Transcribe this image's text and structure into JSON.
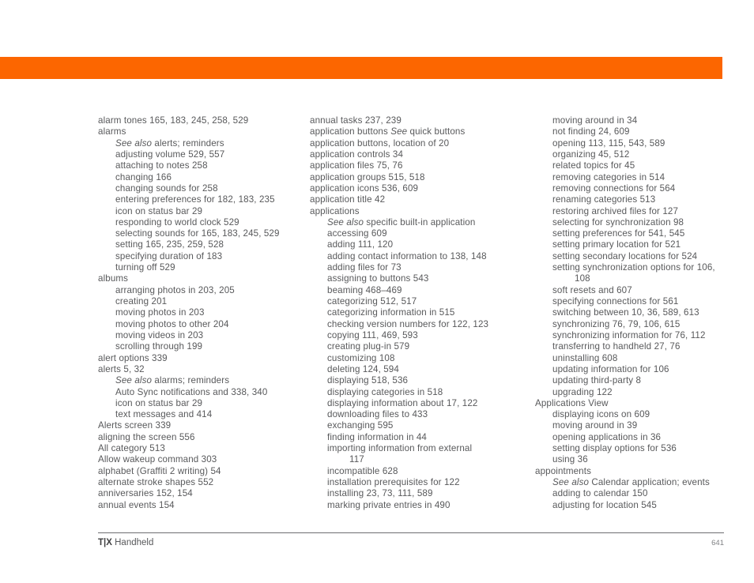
{
  "page": {
    "accent_color": "#fc6600",
    "text_color": "#58595b"
  },
  "footer": {
    "brand": "T|X",
    "product": " Handheld",
    "page_number": "641"
  },
  "columns": [
    {
      "name": "index-column-1",
      "entries": [
        {
          "level": 0,
          "text": "alarm tones 165, 183, 245, 258, 529"
        },
        {
          "level": 0,
          "text": "alarms"
        },
        {
          "level": 1,
          "italic_prefix": "See also",
          "text": " alerts; reminders"
        },
        {
          "level": 1,
          "text": "adjusting volume 529, 557"
        },
        {
          "level": 1,
          "text": "attaching to notes 258"
        },
        {
          "level": 1,
          "text": "changing 166"
        },
        {
          "level": 1,
          "text": "changing sounds for 258"
        },
        {
          "level": 1,
          "text": "entering preferences for 182, 183, 235"
        },
        {
          "level": 1,
          "text": "icon on status bar 29"
        },
        {
          "level": 1,
          "text": "responding to world clock 529"
        },
        {
          "level": 1,
          "text": "selecting sounds for 165, 183, 245, 529"
        },
        {
          "level": 1,
          "text": "setting 165, 235, 259, 528"
        },
        {
          "level": 1,
          "text": "specifying duration of 183"
        },
        {
          "level": 1,
          "text": "turning off 529"
        },
        {
          "level": 0,
          "text": "albums"
        },
        {
          "level": 1,
          "text": "arranging photos in 203, 205"
        },
        {
          "level": 1,
          "text": "creating 201"
        },
        {
          "level": 1,
          "text": "moving photos in 203"
        },
        {
          "level": 1,
          "text": "moving photos to other 204"
        },
        {
          "level": 1,
          "text": "moving videos in 203"
        },
        {
          "level": 1,
          "text": "scrolling through 199"
        },
        {
          "level": 0,
          "text": "alert options 339"
        },
        {
          "level": 0,
          "text": "alerts 5, 32"
        },
        {
          "level": 1,
          "italic_prefix": "See also",
          "text": " alarms; reminders"
        },
        {
          "level": 1,
          "text": "Auto Sync notifications and 338, 340"
        },
        {
          "level": 1,
          "text": "icon on status bar 29"
        },
        {
          "level": 1,
          "text": "text messages and 414"
        },
        {
          "level": 0,
          "text": "Alerts screen 339"
        },
        {
          "level": 0,
          "text": "aligning the screen 556"
        },
        {
          "level": 0,
          "text": "All category 513"
        },
        {
          "level": 0,
          "text": "Allow wakeup command 303"
        },
        {
          "level": 0,
          "text": "alphabet (Graffiti 2 writing) 54"
        },
        {
          "level": 0,
          "text": "alternate stroke shapes 552"
        },
        {
          "level": 0,
          "text": "anniversaries 152, 154"
        },
        {
          "level": 0,
          "text": "annual events 154"
        }
      ]
    },
    {
      "name": "index-column-2",
      "entries": [
        {
          "level": 0,
          "text": "annual tasks 237, 239"
        },
        {
          "level": 0,
          "text": "application buttons ",
          "italic_mid": "See",
          "text_after": " quick buttons"
        },
        {
          "level": 0,
          "text": "application buttons, location of 20"
        },
        {
          "level": 0,
          "text": "application controls 34"
        },
        {
          "level": 0,
          "text": "application files 75, 76"
        },
        {
          "level": 0,
          "text": "application groups 515, 518"
        },
        {
          "level": 0,
          "text": "application icons 536, 609"
        },
        {
          "level": 0,
          "text": "application title 42"
        },
        {
          "level": 0,
          "text": "applications"
        },
        {
          "level": 1,
          "italic_prefix": "See also",
          "text": " specific built-in application"
        },
        {
          "level": 1,
          "text": "accessing 609"
        },
        {
          "level": 1,
          "text": "adding 111, 120"
        },
        {
          "level": 1,
          "text": "adding contact information to 138, 148"
        },
        {
          "level": 1,
          "text": "adding files for 73"
        },
        {
          "level": 1,
          "text": "assigning to buttons 543"
        },
        {
          "level": 1,
          "text": "beaming 468–469"
        },
        {
          "level": 1,
          "text": "categorizing 512, 517"
        },
        {
          "level": 1,
          "text": "categorizing information in 515"
        },
        {
          "level": 1,
          "text": "checking version numbers for 122, 123"
        },
        {
          "level": 1,
          "text": "copying 111, 469, 593"
        },
        {
          "level": 1,
          "text": "creating plug-in 579"
        },
        {
          "level": 1,
          "text": "customizing 108"
        },
        {
          "level": 1,
          "text": "deleting 124, 594"
        },
        {
          "level": 1,
          "text": "displaying 518, 536"
        },
        {
          "level": 1,
          "text": "displaying categories in 518"
        },
        {
          "level": 1,
          "text": "displaying information about 17, 122"
        },
        {
          "level": 1,
          "text": "downloading files to 433"
        },
        {
          "level": 1,
          "text": "exchanging 595"
        },
        {
          "level": 1,
          "text": "finding information in 44"
        },
        {
          "level": 1,
          "text": "importing information from external"
        },
        {
          "level": 2,
          "text": "117"
        },
        {
          "level": 1,
          "text": "incompatible 628"
        },
        {
          "level": 1,
          "text": "installation prerequisites for 122"
        },
        {
          "level": 1,
          "text": "installing 23, 73, 111, 589"
        },
        {
          "level": 1,
          "text": "marking private entries in 490"
        }
      ]
    },
    {
      "name": "index-column-3",
      "entries": [
        {
          "level": 1,
          "text": "moving around in 34"
        },
        {
          "level": 1,
          "text": "not finding 24, 609"
        },
        {
          "level": 1,
          "text": "opening 113, 115, 543, 589"
        },
        {
          "level": 1,
          "text": "organizing 45, 512"
        },
        {
          "level": 1,
          "text": "related topics for 45"
        },
        {
          "level": 1,
          "text": "removing categories in 514"
        },
        {
          "level": 1,
          "text": "removing connections for 564"
        },
        {
          "level": 1,
          "text": "renaming categories 513"
        },
        {
          "level": 1,
          "text": "restoring archived files for 127"
        },
        {
          "level": 1,
          "text": "selecting for synchronization 98"
        },
        {
          "level": 1,
          "text": "setting preferences for 541, 545"
        },
        {
          "level": 1,
          "text": "setting primary location for 521"
        },
        {
          "level": 1,
          "text": "setting secondary locations for 524"
        },
        {
          "level": 1,
          "text": "setting synchronization options for 106,"
        },
        {
          "level": 2,
          "text": "108"
        },
        {
          "level": 1,
          "text": "soft resets and 607"
        },
        {
          "level": 1,
          "text": "specifying connections for 561"
        },
        {
          "level": 1,
          "text": "switching between 10, 36, 589, 613"
        },
        {
          "level": 1,
          "text": "synchronizing 76, 79, 106, 615"
        },
        {
          "level": 1,
          "text": "synchronizing information for 76, 112"
        },
        {
          "level": 1,
          "text": "transferring to handheld 27, 76"
        },
        {
          "level": 1,
          "text": "uninstalling 608"
        },
        {
          "level": 1,
          "text": "updating information for 106"
        },
        {
          "level": 1,
          "text": "updating third-party 8"
        },
        {
          "level": 1,
          "text": "upgrading 122"
        },
        {
          "level": 0,
          "text": "Applications View"
        },
        {
          "level": 1,
          "text": "displaying icons on 609"
        },
        {
          "level": 1,
          "text": "moving around in 39"
        },
        {
          "level": 1,
          "text": "opening applications in 36"
        },
        {
          "level": 1,
          "text": "setting display options for 536"
        },
        {
          "level": 1,
          "text": "using 36"
        },
        {
          "level": 0,
          "text": "appointments"
        },
        {
          "level": 1,
          "italic_prefix": "See also",
          "text": " Calendar application; events"
        },
        {
          "level": 1,
          "text": "adding to calendar 150"
        },
        {
          "level": 1,
          "text": "adjusting for location 545"
        }
      ]
    }
  ]
}
